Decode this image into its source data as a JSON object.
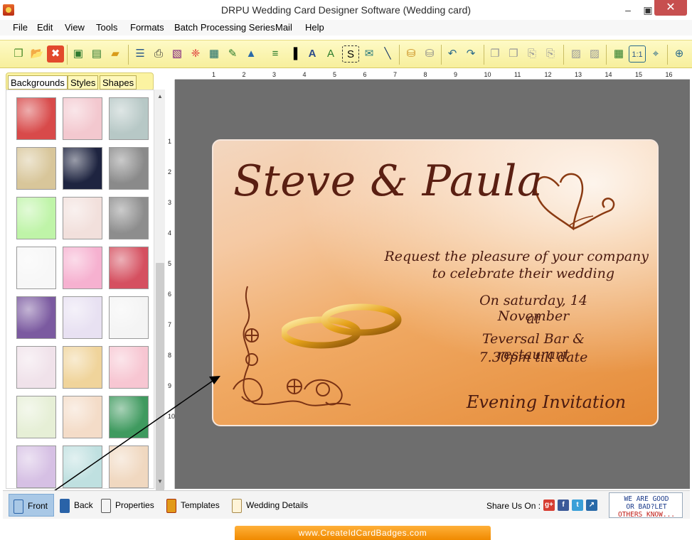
{
  "window": {
    "title": "DRPU Wedding Card Designer Software (Wedding card)",
    "min_glyph": "–",
    "max_glyph": "▣",
    "close_glyph": "✕"
  },
  "menu": [
    "File",
    "Edit",
    "View",
    "Tools",
    "Formats",
    "Batch Processing Series",
    "Mail",
    "Help"
  ],
  "toolbar": {
    "icons": [
      "new-icon",
      "open-icon",
      "close-doc-icon",
      "save-icon",
      "save-as-icon",
      "open-folder-icon",
      "properties-icon",
      "print-icon",
      "print-preview-icon",
      "gift-icon",
      "export-image-icon",
      "pen-icon",
      "insert-picture-icon",
      "watermark-icon",
      "barcode-icon",
      "text-icon",
      "word-art-icon",
      "signature-icon",
      "mail-icon",
      "line-icon",
      "database-icon",
      "database-alt-icon",
      "undo-icon",
      "redo-icon",
      "copy-icon",
      "copy-alt-icon",
      "paste-icon",
      "paste-alt-icon",
      "bring-forward-icon",
      "send-backward-icon",
      "grid-icon",
      "actual-size-icon",
      "fit-icon",
      "zoom-in-icon"
    ]
  },
  "left_panel": {
    "tabs": [
      "Backgrounds",
      "Styles",
      "Shapes"
    ],
    "active_tab": "Backgrounds",
    "swatches": [
      [
        "#d84a4a",
        "#f3c8cf",
        "#b7c8c6"
      ],
      [
        "#d8c69a",
        "#1e2440",
        "#8a8a8a"
      ],
      [
        "#bff4a8",
        "#f2e0dc",
        "#8d8d8d"
      ],
      [
        "#f7f7f7",
        "#f6b1d0",
        "#d55060"
      ],
      [
        "#7b5aa0",
        "#e8e1f2",
        "#f4f4f4"
      ],
      [
        "#f0e2ea",
        "#f0d49b",
        "#f7c6d2"
      ],
      [
        "#e6efd6",
        "#f4dcc8",
        "#3f9a5f"
      ],
      [
        "#d6c0e4",
        "#bfe0e0",
        "#f0d8c0"
      ]
    ]
  },
  "ruler": {
    "top": [
      "1",
      "2",
      "3",
      "4",
      "5",
      "6",
      "7",
      "8",
      "9",
      "10",
      "11",
      "12",
      "13",
      "14",
      "15",
      "16"
    ],
    "left": [
      "1",
      "2",
      "3",
      "4",
      "5",
      "6",
      "7",
      "8",
      "9",
      "10"
    ]
  },
  "card": {
    "names": "Steve  & Paula",
    "line1": "Request the pleasure of your company",
    "line2": "to celebrate their wedding",
    "line3": "On saturday, 14 November",
    "line4": "at",
    "line5": "Teversal Bar & restaurant",
    "line6": "7.30pm till date",
    "line7": "Evening Invitation"
  },
  "bottom": {
    "front": "Front",
    "back": "Back",
    "properties": "Properties",
    "templates": "Templates",
    "wedding_details": "Wedding Details",
    "share_label": "Share Us On :",
    "feedback_line1": "WE ARE GOOD",
    "feedback_line2": "OR BAD?LET",
    "feedback_line3": "OTHERS KNOW..."
  },
  "footer": {
    "url": "www.CreateIdCardBadges.com"
  },
  "colors": {
    "toolbar": "#f7ef9c",
    "canvas": "#6e6e6e",
    "card_text": "#4a1a10",
    "footer": "#f08a00"
  }
}
